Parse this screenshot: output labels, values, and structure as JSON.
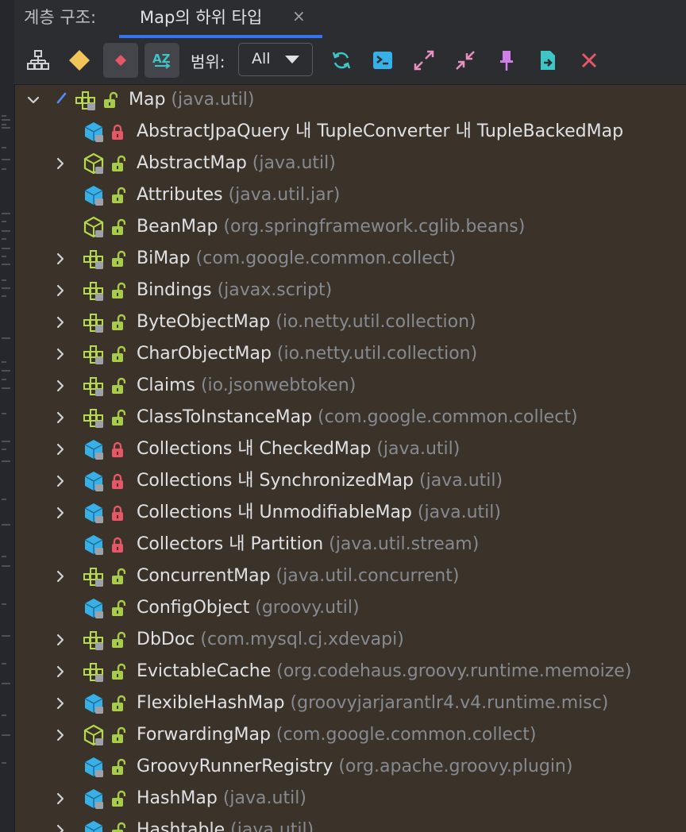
{
  "panel": {
    "title": "계층 구조:",
    "tab_label": "Map의 하위 타입",
    "tab_close": "×"
  },
  "toolbar": {
    "scope_label": "범위:",
    "scope_value": "All",
    "selected_button": "sort-alphabetically-button"
  },
  "colors": {
    "background": "#3b3229",
    "toolbar_bg": "#2b2d30",
    "accent": "#3574f0",
    "name_text": "#dfe1e5",
    "package_text": "#868a91",
    "interface_icon": "#b6d84c",
    "class_icon": "#37b0e8",
    "lock_public": "#a7cc48",
    "lock_private": "#e55765"
  },
  "tree": {
    "root": {
      "name": "Map",
      "package": "(java.util)",
      "icon": "interface-icon",
      "expanded": true
    },
    "items": [
      {
        "name": "AbstractJpaQuery 내 TupleConverter 내 TupleBackedMap",
        "package": "",
        "icon": "class-icon",
        "access": "private",
        "expandable": false
      },
      {
        "name": "AbstractMap",
        "package": "(java.util)",
        "icon": "abstract-class-icon",
        "access": "public",
        "expandable": true
      },
      {
        "name": "Attributes",
        "package": "(java.util.jar)",
        "icon": "class-icon",
        "access": "public",
        "expandable": false
      },
      {
        "name": "BeanMap",
        "package": "(org.springframework.cglib.beans)",
        "icon": "abstract-class-icon",
        "access": "public",
        "expandable": false
      },
      {
        "name": "BiMap",
        "package": "(com.google.common.collect)",
        "icon": "interface-icon",
        "access": "public",
        "expandable": true
      },
      {
        "name": "Bindings",
        "package": "(javax.script)",
        "icon": "interface-icon",
        "access": "public",
        "expandable": true
      },
      {
        "name": "ByteObjectMap",
        "package": "(io.netty.util.collection)",
        "icon": "interface-icon",
        "access": "public",
        "expandable": true
      },
      {
        "name": "CharObjectMap",
        "package": "(io.netty.util.collection)",
        "icon": "interface-icon",
        "access": "public",
        "expandable": true
      },
      {
        "name": "Claims",
        "package": "(io.jsonwebtoken)",
        "icon": "interface-icon",
        "access": "public",
        "expandable": true
      },
      {
        "name": "ClassToInstanceMap",
        "package": "(com.google.common.collect)",
        "icon": "interface-icon",
        "access": "public",
        "expandable": true
      },
      {
        "name": "Collections 내 CheckedMap",
        "package": "(java.util)",
        "icon": "class-icon",
        "access": "private",
        "expandable": true
      },
      {
        "name": "Collections 내 SynchronizedMap",
        "package": "(java.util)",
        "icon": "class-icon",
        "access": "private",
        "expandable": true
      },
      {
        "name": "Collections 내 UnmodifiableMap",
        "package": "(java.util)",
        "icon": "class-icon",
        "access": "private",
        "expandable": true
      },
      {
        "name": "Collectors 내 Partition",
        "package": "(java.util.stream)",
        "icon": "class-icon",
        "access": "private",
        "expandable": false
      },
      {
        "name": "ConcurrentMap",
        "package": "(java.util.concurrent)",
        "icon": "interface-icon",
        "access": "public",
        "expandable": true
      },
      {
        "name": "ConfigObject",
        "package": "(groovy.util)",
        "icon": "class-icon",
        "access": "public",
        "expandable": false
      },
      {
        "name": "DbDoc",
        "package": "(com.mysql.cj.xdevapi)",
        "icon": "interface-icon",
        "access": "public",
        "expandable": true
      },
      {
        "name": "EvictableCache",
        "package": "(org.codehaus.groovy.runtime.memoize)",
        "icon": "interface-icon",
        "access": "public",
        "expandable": true
      },
      {
        "name": "FlexibleHashMap",
        "package": "(groovyjarjarantlr4.v4.runtime.misc)",
        "icon": "class-icon",
        "access": "public",
        "expandable": true
      },
      {
        "name": "ForwardingMap",
        "package": "(com.google.common.collect)",
        "icon": "abstract-class-icon",
        "access": "public",
        "expandable": true
      },
      {
        "name": "GroovyRunnerRegistry",
        "package": "(org.apache.groovy.plugin)",
        "icon": "class-icon",
        "access": "public",
        "expandable": false
      },
      {
        "name": "HashMap",
        "package": "(java.util)",
        "icon": "class-icon",
        "access": "public",
        "expandable": true
      },
      {
        "name": "Hashtable",
        "package": "(java.util)",
        "icon": "class-icon",
        "access": "public",
        "expandable": true
      }
    ]
  }
}
